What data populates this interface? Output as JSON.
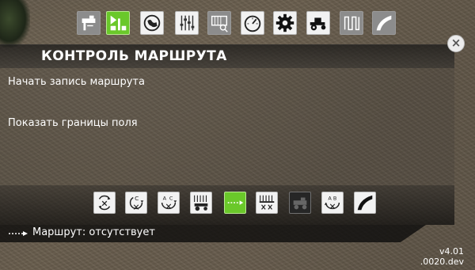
{
  "top_toolbar": [
    {
      "icon": "guidance-line-icon",
      "state": "grey"
    },
    {
      "icon": "field-layout-icon",
      "state": "green"
    },
    {
      "icon": "globe-icon",
      "state": "white"
    },
    {
      "icon": "sliders-icon",
      "state": "white"
    },
    {
      "icon": "field-search-icon",
      "state": "grey"
    },
    {
      "icon": "gauge-icon",
      "state": "white"
    },
    {
      "icon": "gear-icon",
      "state": "white"
    },
    {
      "icon": "tractor-icon",
      "state": "white"
    },
    {
      "icon": "zigzag-path-icon",
      "state": "grey"
    },
    {
      "icon": "curve-path-icon",
      "state": "grey"
    }
  ],
  "dialog": {
    "title": "КОНТРОЛЬ МАРШРУТА",
    "options": [
      "Начать запись маршрута",
      "Показать границы поля"
    ]
  },
  "bottom_toolbar": [
    {
      "icon": "cycle-clear-icon",
      "state": "white"
    },
    {
      "icon": "cycle-c-icon",
      "state": "white"
    },
    {
      "icon": "cycle-ac-icon",
      "state": "white"
    },
    {
      "icon": "sections-tractor-icon",
      "state": "white"
    },
    {
      "icon": "dashed-route-icon",
      "state": "green"
    },
    {
      "icon": "sections-clear-icon",
      "state": "white"
    },
    {
      "icon": "tractor-disabled-icon",
      "state": "dark"
    },
    {
      "icon": "cycle-ab-icon",
      "state": "white"
    },
    {
      "icon": "curve-path-icon",
      "state": "white"
    }
  ],
  "status": {
    "text": "Маршрут: отсутствует",
    "icon": "route-dash-icon"
  },
  "close_label": "×",
  "version": {
    "line1": "v4.01",
    "line2": ".0020.dev"
  },
  "colors": {
    "accent_green": "#6ac82a",
    "tile_white": "#f2f2f2",
    "tile_grey": "#8c8c8c",
    "panel_dark": "#1a1a1a"
  }
}
